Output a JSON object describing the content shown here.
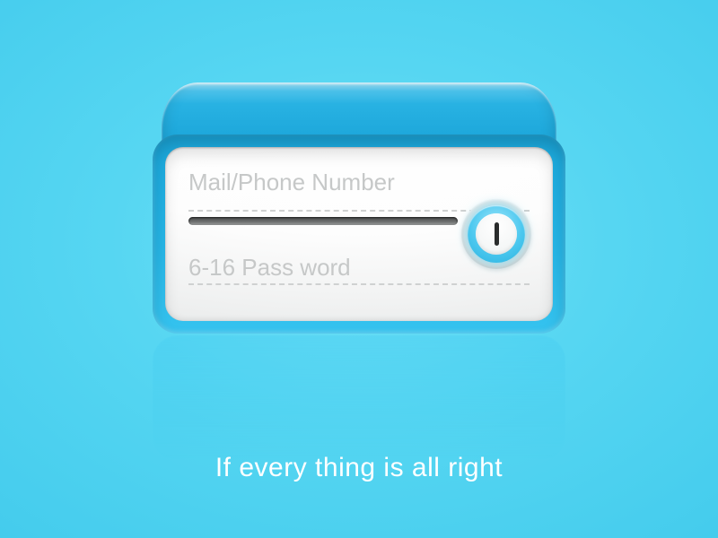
{
  "form": {
    "username": {
      "placeholder": "Mail/Phone Number",
      "value": ""
    },
    "password": {
      "placeholder": "6-16 Pass word",
      "value": ""
    }
  },
  "caption": "If every thing is all right",
  "colors": {
    "background": "#4fd2ef",
    "device": "#1aa6da",
    "accent_ring": "#4cc8ef"
  }
}
